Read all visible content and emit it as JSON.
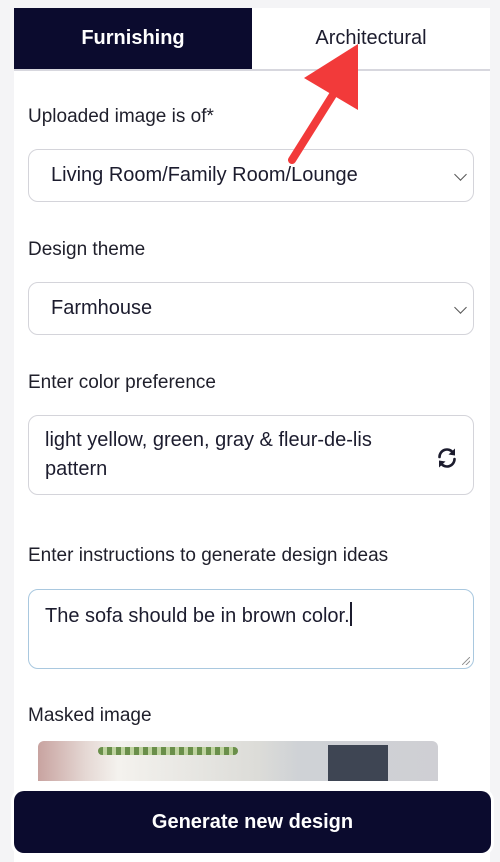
{
  "tabs": [
    {
      "label": "Furnishing",
      "active": true
    },
    {
      "label": "Architectural",
      "active": false
    }
  ],
  "form": {
    "room": {
      "label": "Uploaded image is of*",
      "value": "Living Room/Family Room/Lounge"
    },
    "theme": {
      "label": "Design theme",
      "value": "Farmhouse"
    },
    "color": {
      "label": "Enter color preference",
      "value": "light yellow, green, gray & fleur-de-lis pattern"
    },
    "instructions": {
      "label": "Enter instructions to generate design ideas",
      "value": "The sofa should be in brown color."
    },
    "masked": {
      "label": "Masked image"
    }
  },
  "generate_label": "Generate new design",
  "colors": {
    "accent": "#0b0b2e",
    "annotation_arrow": "#f23a3a"
  }
}
